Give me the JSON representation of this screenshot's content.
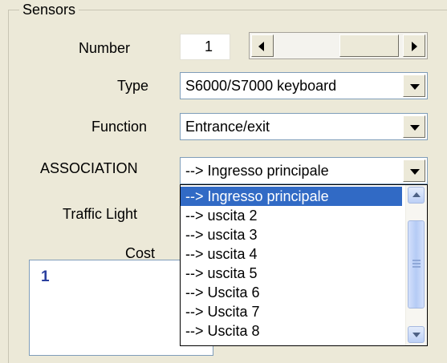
{
  "group": {
    "title": "Sensors"
  },
  "number": {
    "label": "Number",
    "value": "1"
  },
  "type": {
    "label": "Type",
    "value": "S6000/S7000 keyboard"
  },
  "function": {
    "label": "Function",
    "value": "Entrance/exit"
  },
  "association": {
    "label": "ASSOCIATION",
    "value": "--> Ingresso principale",
    "options": [
      "--> Ingresso principale",
      "--> uscita  2",
      "--> uscita  3",
      "--> uscita  4",
      "--> uscita  5",
      "--> Uscita  6",
      "--> Uscita  7",
      "--> Uscita  8"
    ],
    "selected_index": 0
  },
  "traffic_light": {
    "label": "Traffic Light"
  },
  "cost": {
    "label": "Cost"
  },
  "notes": {
    "value": "1"
  }
}
